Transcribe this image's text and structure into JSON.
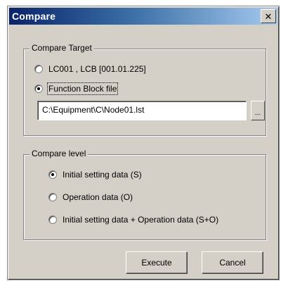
{
  "window": {
    "title": "Compare",
    "close_glyph": "✕"
  },
  "compare_target": {
    "legend": "Compare Target",
    "options": [
      {
        "label": "LC001 , LCB [001.01.225]",
        "selected": false
      },
      {
        "label": "Function Block file",
        "selected": true
      }
    ],
    "file_path": "C:\\Equipment\\C\\Node01.lst",
    "browse_label": "..."
  },
  "compare_level": {
    "legend": "Compare level",
    "options": [
      {
        "label": "Initial setting data (S)",
        "selected": true
      },
      {
        "label": "Operation data (O)",
        "selected": false
      },
      {
        "label": "Initial setting data + Operation data (S+O)",
        "selected": false
      }
    ]
  },
  "buttons": {
    "execute": "Execute",
    "cancel": "Cancel"
  }
}
